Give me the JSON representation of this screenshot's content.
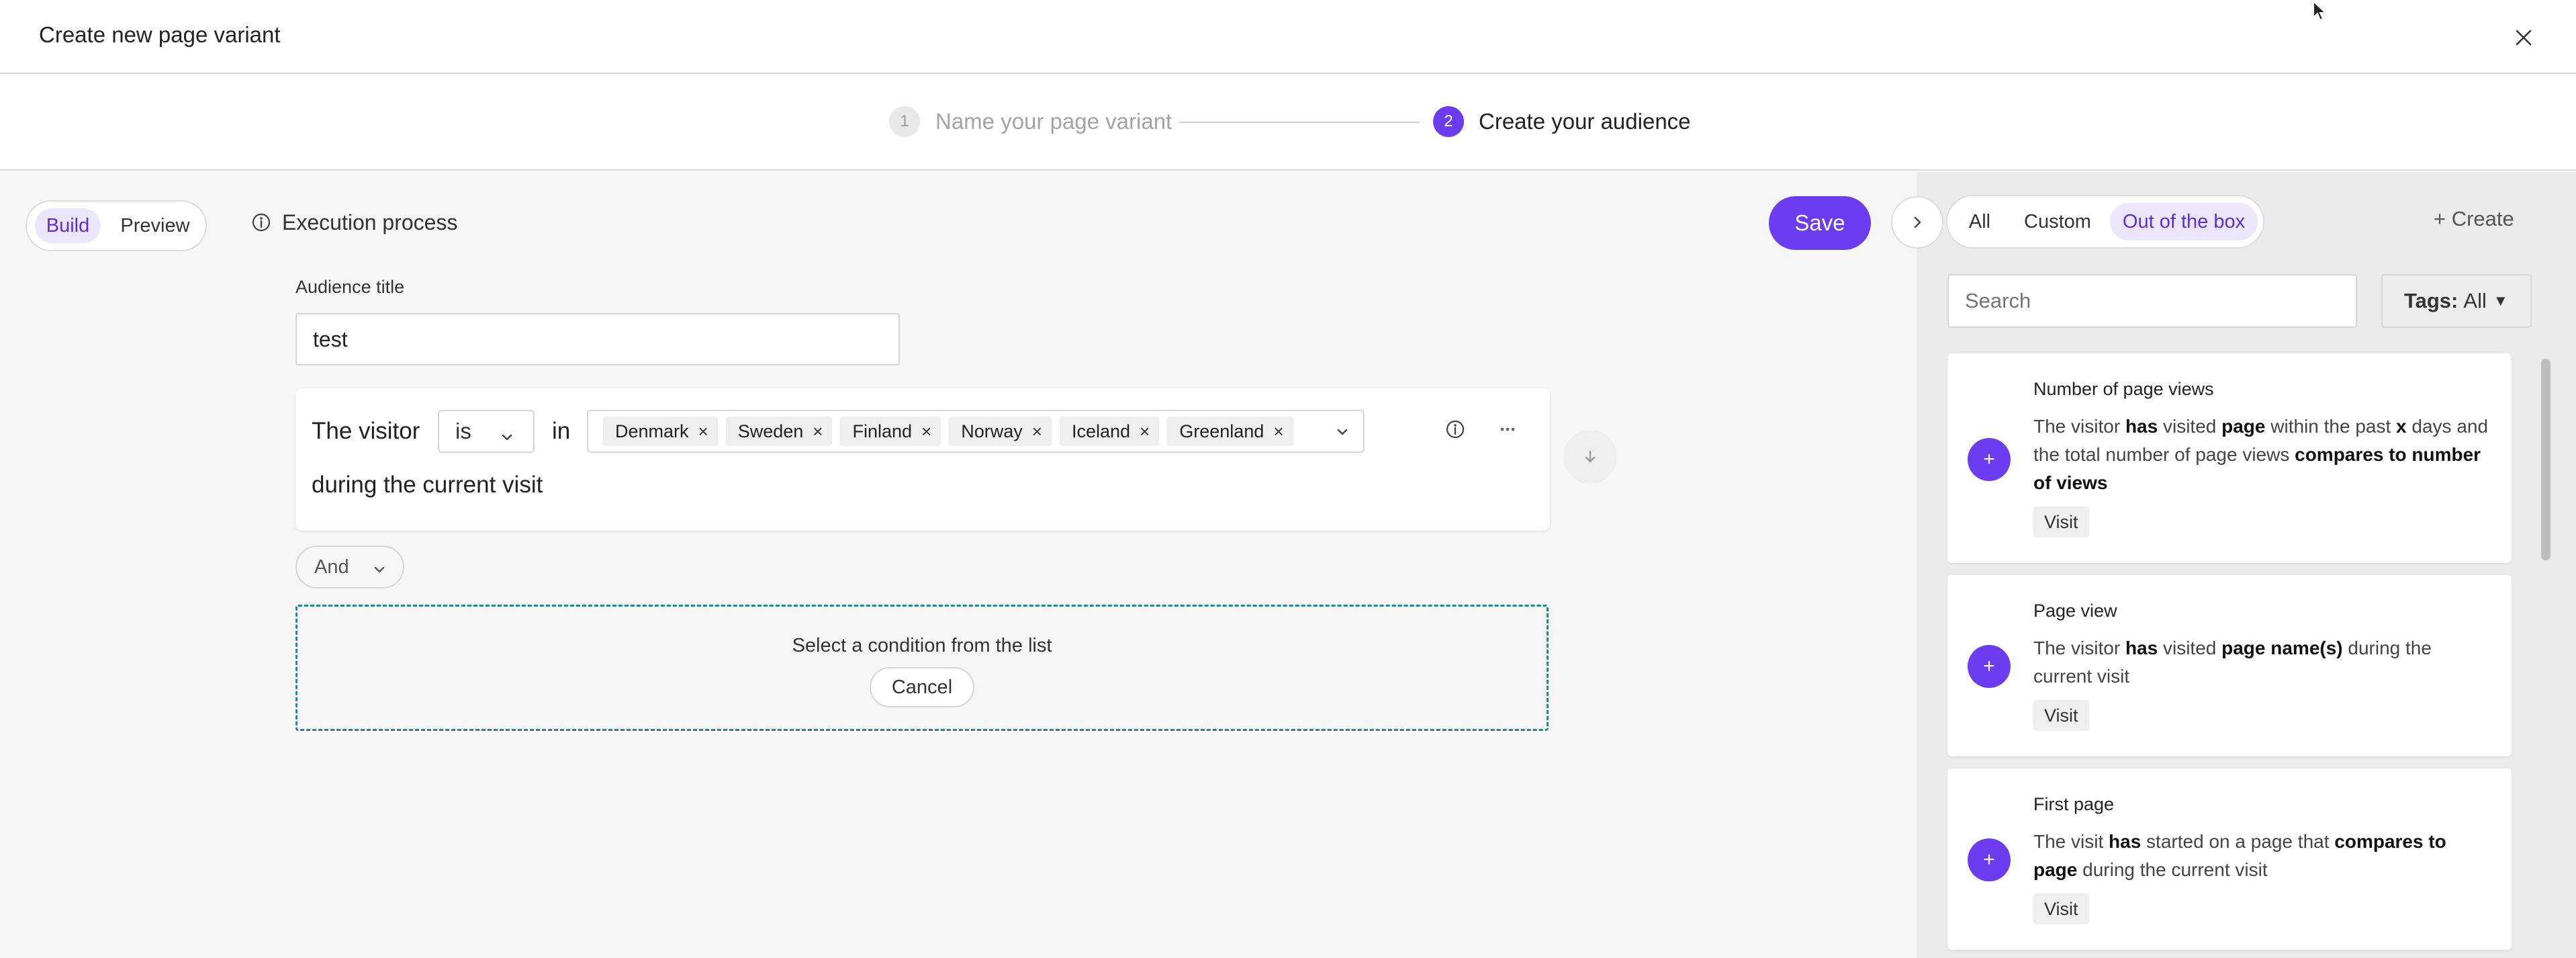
{
  "modal": {
    "title": "Create new page variant"
  },
  "stepper": {
    "steps": [
      {
        "number": "1",
        "label": "Name your page variant"
      },
      {
        "number": "2",
        "label": "Create your audience"
      }
    ]
  },
  "toolbar": {
    "build_label": "Build",
    "preview_label": "Preview",
    "execution_label": "Execution process",
    "save_label": "Save"
  },
  "audience": {
    "title_label": "Audience title",
    "title_value": "test"
  },
  "condition": {
    "subject": "The visitor",
    "operator": "is",
    "preposition": "in",
    "values": [
      "Denmark",
      "Sweden",
      "Finland",
      "Norway",
      "Iceland",
      "Greenland"
    ],
    "suffix": "during the current visit"
  },
  "logic": {
    "join_label": "And"
  },
  "placeholder": {
    "text": "Select a condition from the list",
    "cancel_label": "Cancel"
  },
  "panel": {
    "tabs": [
      "All",
      "Custom",
      "Out of the box"
    ],
    "active_tab": "Out of the box",
    "create_label": "+ Create",
    "search_placeholder": "Search",
    "tags_label": "Tags:",
    "tags_value": "All",
    "cards": [
      {
        "title": "Number of page views",
        "desc_parts": [
          "The visitor ",
          "has",
          " visited ",
          "page",
          " within the past ",
          "x",
          " days and the total number of page views ",
          "compares to number of views",
          ""
        ],
        "tag": "Visit"
      },
      {
        "title": "Page view",
        "desc_parts": [
          "The visitor ",
          "has",
          " visited ",
          "page name(s)",
          " during the current visit"
        ],
        "tag": "Visit"
      },
      {
        "title": "First page",
        "desc_parts": [
          "The visit ",
          "has",
          " started on a page that ",
          "compares to page",
          " during the current visit"
        ],
        "tag": "Visit"
      }
    ]
  },
  "colors": {
    "accent": "#6c3cf0",
    "accent_light": "#ece6fd",
    "dashed_border": "#1f8a86"
  }
}
